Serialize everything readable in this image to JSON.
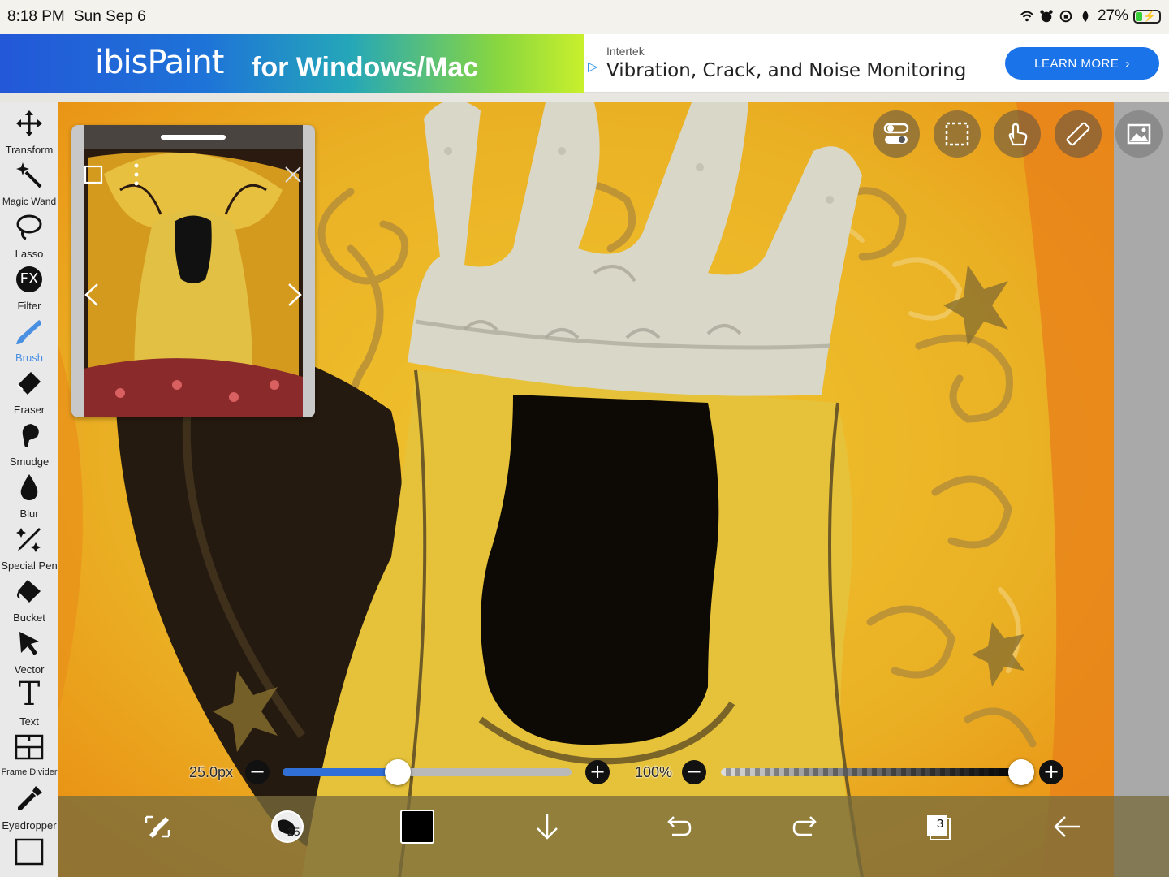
{
  "status_bar": {
    "time": "8:18 PM",
    "date": "Sun Sep 6",
    "battery": "27%",
    "battery_level": 0.27
  },
  "ad": {
    "logo": "ibisPaint",
    "tagline": "for Windows/Mac",
    "sponsor": "Intertek",
    "headline": "Vibration, Crack, and Noise Monitoring",
    "cta": "LEARN MORE"
  },
  "toolbar": {
    "tools": [
      {
        "label": "Transform",
        "icon": "move-arrows-icon"
      },
      {
        "label": "Magic Wand",
        "icon": "magic-wand-icon"
      },
      {
        "label": "Lasso",
        "icon": "lasso-icon"
      },
      {
        "label": "Filter",
        "icon": "fx-icon",
        "glyph": "FX"
      },
      {
        "label": "Brush",
        "icon": "brush-icon",
        "active": true
      },
      {
        "label": "Eraser",
        "icon": "eraser-icon"
      },
      {
        "label": "Smudge",
        "icon": "smudge-icon"
      },
      {
        "label": "Blur",
        "icon": "drop-icon"
      },
      {
        "label": "Special Pen",
        "icon": "sparkle-pen-icon"
      },
      {
        "label": "Bucket",
        "icon": "bucket-icon"
      },
      {
        "label": "Vector",
        "icon": "cursor-arrow-icon"
      },
      {
        "label": "Text",
        "icon": "text-icon",
        "glyph": "T"
      },
      {
        "label": "Frame Divider",
        "icon": "frame-divider-icon"
      },
      {
        "label": "Eyedropper",
        "icon": "eyedropper-icon"
      }
    ]
  },
  "canvas_controls": {
    "icons": [
      "toggle-switch-icon",
      "selection-rect-icon",
      "touch-hand-icon",
      "ruler-icon",
      "reference-image-icon"
    ]
  },
  "reference_window": {
    "icons": [
      "checkbox-icon",
      "more-vertical-icon",
      "close-icon",
      "chevron-left-icon",
      "chevron-right-icon"
    ]
  },
  "brush_size": {
    "label": "25.0px",
    "value": 25.0,
    "level": 0.4
  },
  "opacity": {
    "label": "100%",
    "value": 100,
    "level": 1.0
  },
  "bottom_bar": {
    "brush_size_badge": "25",
    "color": "#000000",
    "layer_count": "3",
    "icons": [
      "swap-brush-eraser-icon",
      "brush-preview-icon",
      "color-swatch-icon",
      "down-arrow-icon",
      "undo-icon",
      "redo-icon",
      "layers-icon",
      "back-arrow-icon"
    ]
  }
}
